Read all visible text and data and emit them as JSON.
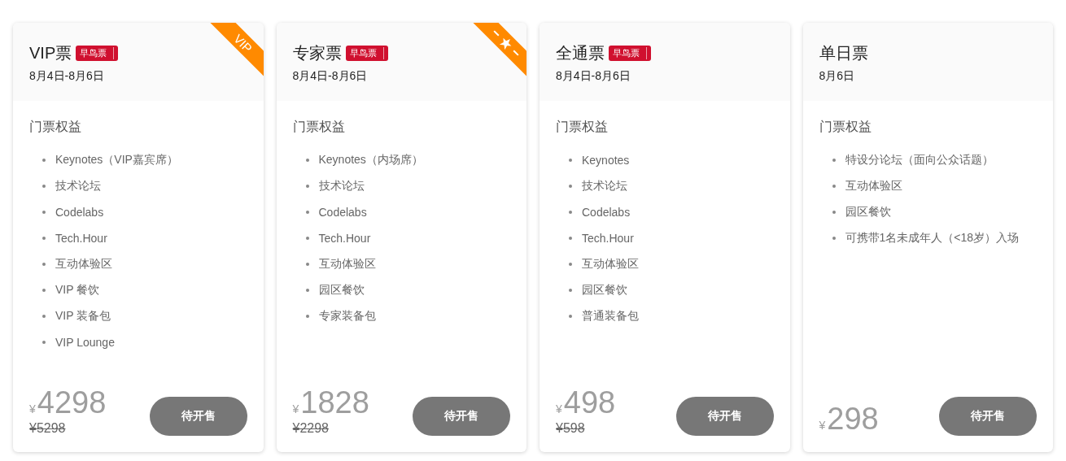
{
  "tickets": [
    {
      "name": "VIP票",
      "badge": "早鸟票",
      "dates": "8月4日-8月6日",
      "ribbon": {
        "kind": "text",
        "label": "VIP"
      },
      "benefits_title": "门票权益",
      "benefits": [
        "Keynotes（VIP嘉宾席）",
        "技术论坛",
        "Codelabs",
        "Tech.Hour",
        "互动体验区",
        "VIP 餐饮",
        "VIP 装备包",
        "VIP Lounge"
      ],
      "currency": "¥",
      "price": "4298",
      "old_price": "¥5298",
      "button": "待开售"
    },
    {
      "name": "专家票",
      "badge": "早鸟票",
      "dates": "8月4日-8月6日",
      "ribbon": {
        "kind": "star"
      },
      "benefits_title": "门票权益",
      "benefits": [
        "Keynotes（内场席）",
        "技术论坛",
        "Codelabs",
        "Tech.Hour",
        "互动体验区",
        "园区餐饮",
        "专家装备包"
      ],
      "currency": "¥",
      "price": "1828",
      "old_price": "¥2298",
      "button": "待开售"
    },
    {
      "name": "全通票",
      "badge": "早鸟票",
      "dates": "8月4日-8月6日",
      "benefits_title": "门票权益",
      "benefits": [
        "Keynotes",
        "技术论坛",
        "Codelabs",
        "Tech.Hour",
        "互动体验区",
        "园区餐饮",
        "普通装备包"
      ],
      "currency": "¥",
      "price": "498",
      "old_price": "¥598",
      "button": "待开售"
    },
    {
      "name": "单日票",
      "dates": "8月6日",
      "benefits_title": "门票权益",
      "benefits": [
        "特设分论坛（面向公众话题）",
        "互动体验区",
        "园区餐饮",
        "可携带1名未成年人（<18岁）入场"
      ],
      "currency": "¥",
      "price": "298",
      "button": "待开售"
    }
  ]
}
